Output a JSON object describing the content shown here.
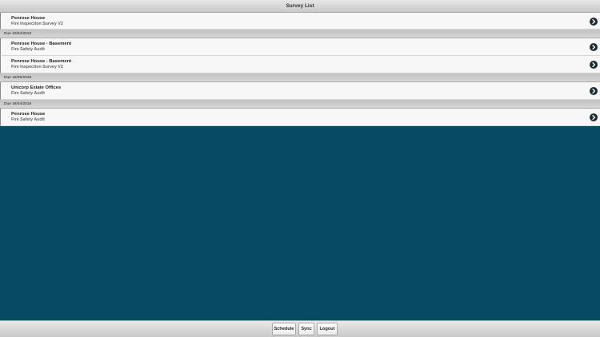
{
  "header": {
    "title": "Survey List"
  },
  "colors": {
    "background": "#064b63",
    "chevron": "#1d2b33"
  },
  "surveys": [
    {
      "title": "Penrose House",
      "subtitle": "Fire Inspection Survey V2",
      "icon": "chevron-right-icon"
    },
    {
      "due_label": "Due 10/04/2016"
    },
    {
      "title": "Penrose House - Basement",
      "subtitle": "Fire Safety Audit",
      "icon": "chevron-right-icon"
    },
    {
      "title": "Penrose House - Basement",
      "subtitle": "Fire Inspection Survey V2",
      "icon": "chevron-right-icon"
    },
    {
      "due_label": "Due 15/05/2016"
    },
    {
      "title": "Unicorp Estate Offices",
      "subtitle": "Fire Safety Audit",
      "icon": "chevron-right-icon"
    },
    {
      "due_label": "Due 18/04/2016"
    },
    {
      "title": "Penrose House",
      "subtitle": "Fire Safety Audit",
      "icon": "chevron-right-icon"
    }
  ],
  "footer": {
    "schedule_label": "Schedule",
    "sync_label": "Sync",
    "logout_label": "Logout"
  }
}
